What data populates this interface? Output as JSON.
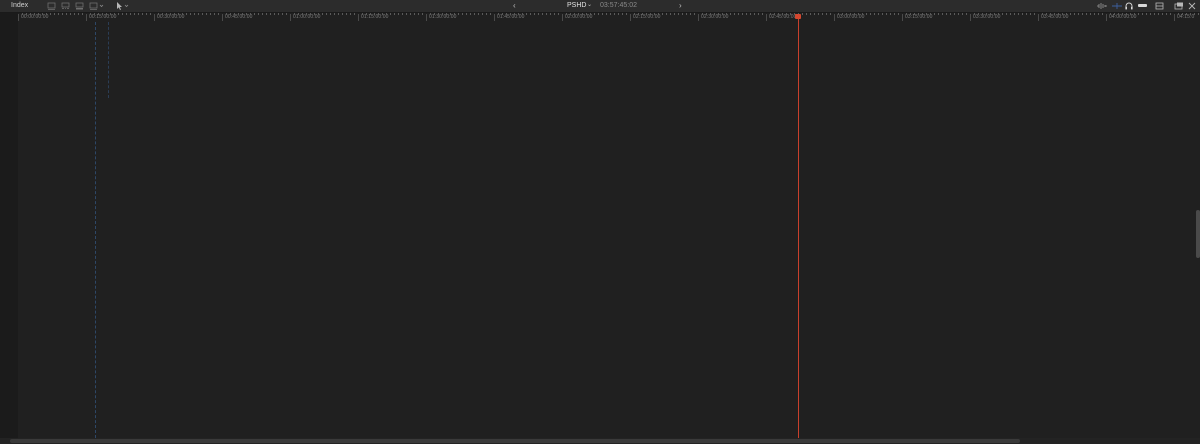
{
  "toolbar": {
    "index_label": "Index",
    "nav_prev": "‹",
    "nav_next": "›",
    "project_name": "PSHD",
    "project_chevron": "⌄",
    "duration": "03:57:45:02"
  },
  "ruler": {
    "labels": [
      "00:00:00:00",
      "00:15:00:00",
      "00:30:00:00",
      "00:45:00:00",
      "01:00:00:00",
      "01:15:00:00",
      "01:30:00:00",
      "01:45:00:00",
      "02:00:00:00",
      "02:15:00:00",
      "02:30:00:00",
      "02:45:00:00",
      "03:00:00:00",
      "03:15:00:00",
      "03:30:00:00",
      "03:45:00:00",
      "04:00:00:00",
      "04:15:0"
    ]
  },
  "playhead": {
    "timecode": "02:45:00:00",
    "color": "#d4472f"
  },
  "colors": {
    "background": "#1f1f1f",
    "toolbar": "#2c2c2c",
    "accent_playhead": "#c8402c",
    "marker_dashed": "#2e4766"
  },
  "icons": {
    "clip_appearance_1": "clip-appearance-icon",
    "clip_appearance_2": "clip-appearance-filmstrip-icon",
    "clip_appearance_3": "clip-appearance-audio-icon",
    "clip_appearance_4": "clip-appearance-menu-icon",
    "select_tool": "arrow-select-tool-icon",
    "audio_skimming": "audio-skimming-icon",
    "video_skimming": "skimming-icon",
    "headphones": "headphones-icon",
    "snapping": "snapping-icon",
    "clip_appearance": "clip-appearance-toggle-icon",
    "window_layout": "window-layout-icon",
    "close": "close-icon"
  }
}
